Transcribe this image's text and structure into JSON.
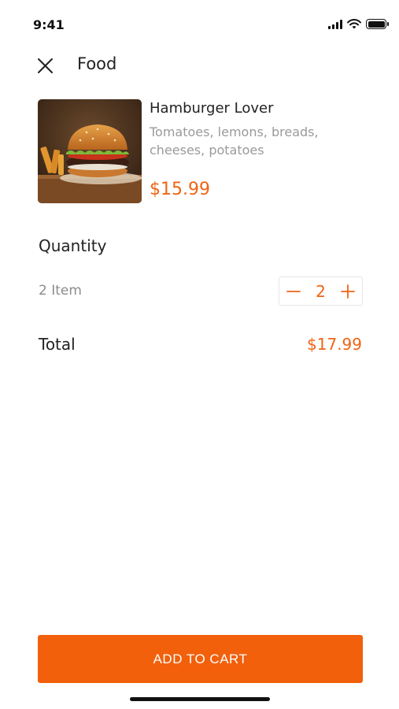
{
  "status_bar": {
    "time": "9:41",
    "icons": [
      "signal-icon",
      "wifi-icon",
      "battery-icon"
    ]
  },
  "header": {
    "close_icon": "close-icon",
    "title": "Food"
  },
  "product": {
    "image": "hamburger-photo",
    "name": "Hamburger Lover",
    "description": "Tomatoes, lemons, breads, cheeses, potatoes",
    "price": "$15.99"
  },
  "quantity": {
    "heading": "Quantity",
    "item_count_label": "2 Item",
    "value": "2",
    "decrement_icon": "minus-icon",
    "increment_icon": "plus-icon"
  },
  "total": {
    "label": "Total",
    "value": "$17.99"
  },
  "cta": {
    "label": "ADD TO CART"
  },
  "colors": {
    "accent": "#f2600c",
    "text_primary": "#222222",
    "text_secondary": "#9a9a9a"
  }
}
